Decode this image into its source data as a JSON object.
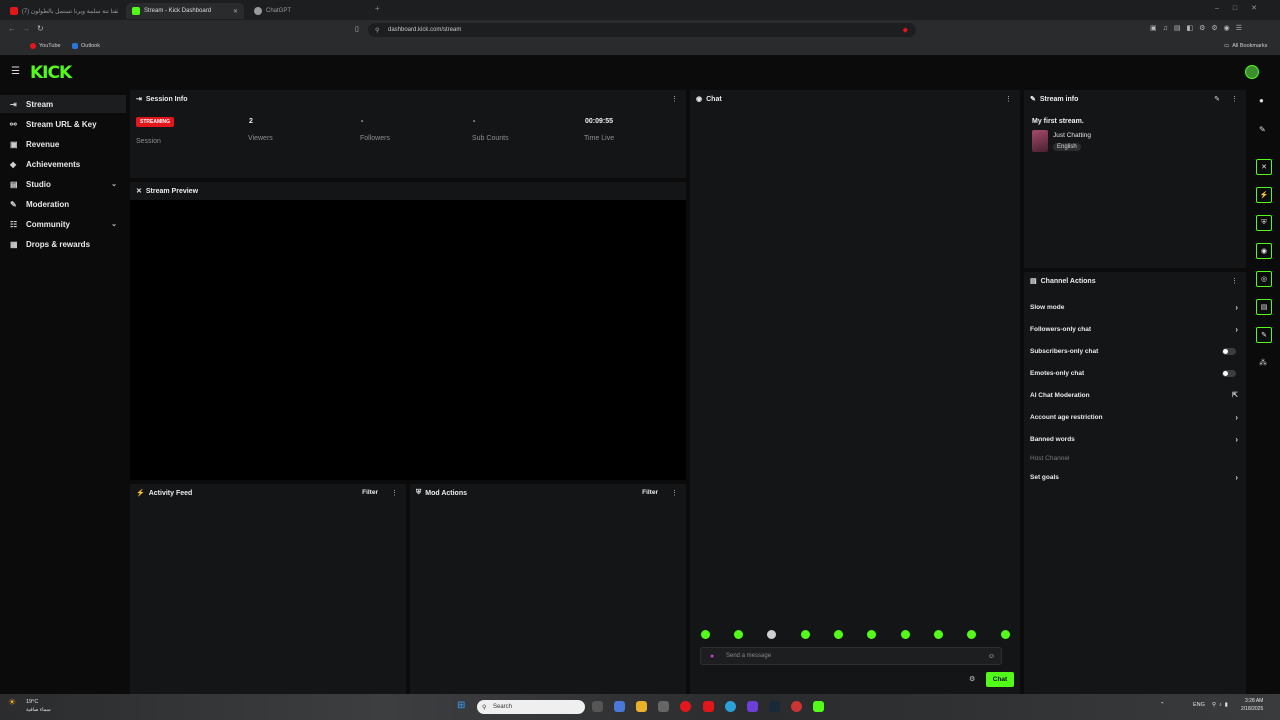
{
  "browser": {
    "tabs": [
      {
        "label": "القنا تنة سلمة ويرنا تستمل بالطولون (7)",
        "color": "#e2161b"
      },
      {
        "label": "Stream - Kick Dashboard",
        "color": "#53fc18"
      },
      {
        "label": "ChatGPT",
        "color": "#9a9a9a"
      }
    ],
    "url": "dashboard.kick.com/stream",
    "bookmarks": [
      {
        "label": "YouTube",
        "color": "#e2161b"
      },
      {
        "label": "Outlook",
        "color": "#2b74d8"
      }
    ],
    "all_bookmarks": "All Bookmarks"
  },
  "header": {
    "logo": "KICK"
  },
  "sidebar": {
    "items": [
      {
        "label": "Stream",
        "icon": "⇥",
        "chevron": ""
      },
      {
        "label": "Stream URL & Key",
        "icon": "⚯",
        "chevron": ""
      },
      {
        "label": "Revenue",
        "icon": "▣",
        "chevron": ""
      },
      {
        "label": "Achievements",
        "icon": "◆",
        "chevron": ""
      },
      {
        "label": "Studio",
        "icon": "▤",
        "chevron": "⌄"
      },
      {
        "label": "Moderation",
        "icon": "✎",
        "chevron": ""
      },
      {
        "label": "Community",
        "icon": "☷",
        "chevron": "⌄"
      },
      {
        "label": "Drops & rewards",
        "icon": "▦",
        "chevron": ""
      }
    ]
  },
  "session": {
    "title": "Session Info",
    "badge": "STREAMING",
    "session_label": "Session",
    "stats": [
      {
        "value": "2",
        "label": "Viewers"
      },
      {
        "value": "-",
        "label": "Followers"
      },
      {
        "value": "-",
        "label": "Sub Counts"
      },
      {
        "value": "00:09:55",
        "label": "Time Live"
      }
    ]
  },
  "preview": {
    "title": "Stream Preview"
  },
  "activity": {
    "title": "Activity Feed",
    "filter": "Filter"
  },
  "mod_actions": {
    "title": "Mod Actions",
    "filter": "Filter"
  },
  "chat": {
    "title": "Chat",
    "placeholder": "Send a message",
    "send_label": "Chat"
  },
  "stream_info": {
    "title": "Stream info",
    "stream_title": "My first stream.",
    "category": "Just Chatting",
    "language": "English"
  },
  "channel_actions": {
    "title": "Channel Actions",
    "items": [
      {
        "label": "Slow mode",
        "control": "chevron"
      },
      {
        "label": "Followers-only chat",
        "control": "chevron"
      },
      {
        "label": "Subscribers-only chat",
        "control": "toggle"
      },
      {
        "label": "Emotes-only chat",
        "control": "toggle"
      },
      {
        "label": "AI Chat Moderation",
        "control": "external"
      },
      {
        "label": "Account age restriction",
        "control": "chevron"
      },
      {
        "label": "Banned words",
        "control": "chevron"
      },
      {
        "label": "Host Channel",
        "control": "none"
      },
      {
        "label": "Set goals",
        "control": "chevron"
      }
    ]
  },
  "taskbar": {
    "search": "Search",
    "weather": "19°C",
    "weather_desc": "سماء صافية",
    "lang": "ENG",
    "time": "3:28 AM",
    "date": "2/18/2025"
  },
  "colors": {
    "accent": "#53fc18",
    "live": "#e2161b",
    "panel": "#141517",
    "bg": "#0b0b0c"
  }
}
